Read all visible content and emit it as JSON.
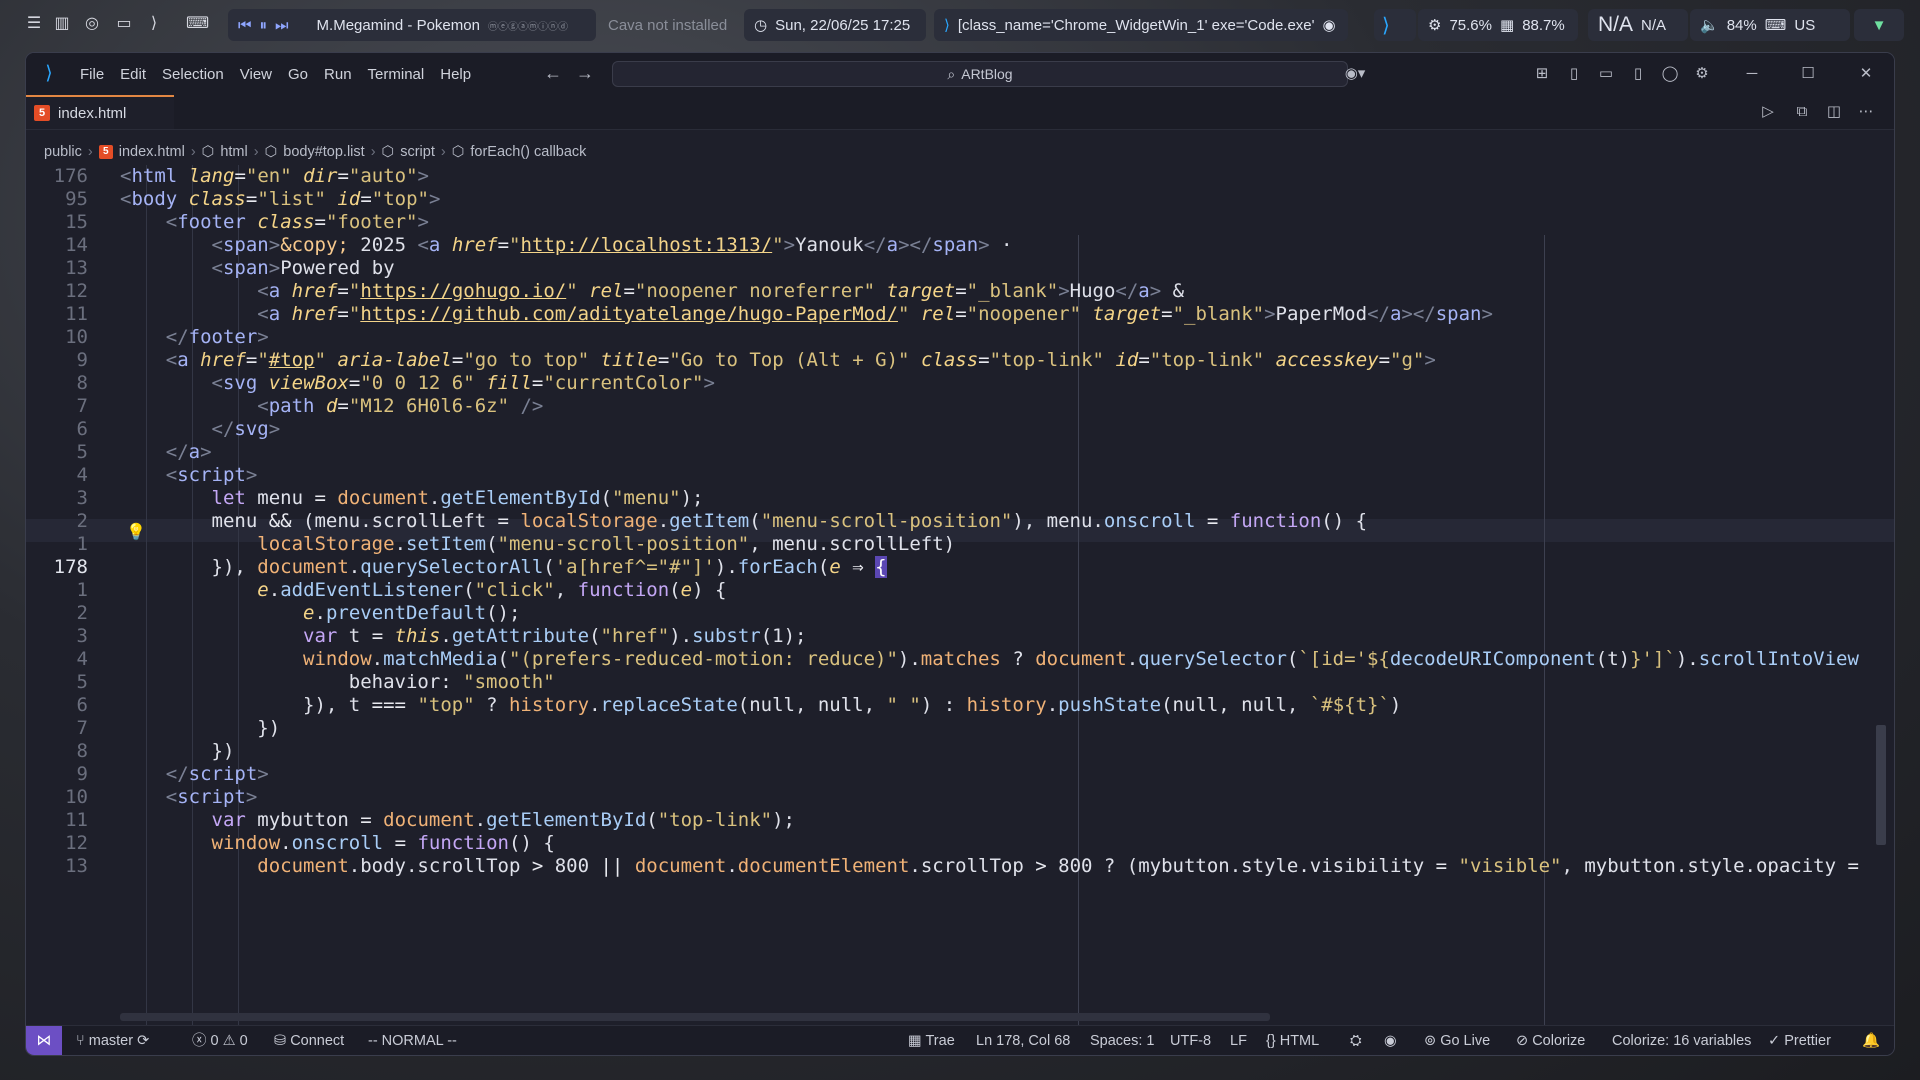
{
  "sysbar": {
    "media_title": "M.Megamind - Pokemon",
    "media_sub": "ⓜⓔⓖⓐⓜⓘⓝⓓ",
    "cava": "Cava not installed",
    "datetime": "Sun, 22/06/25 17:25",
    "window_info": "[class_name='Chrome_WidgetWin_1' exe='Code.exe'",
    "cpu": "75.6%",
    "mem": "88.7%",
    "na_big": "N/A",
    "na_small": "N/A",
    "volume": "84%",
    "lang": "US"
  },
  "titlebar": {
    "menu": [
      "File",
      "Edit",
      "Selection",
      "View",
      "Go",
      "Run",
      "Terminal",
      "Help"
    ],
    "search": "ARtBlog"
  },
  "tab": {
    "filename": "index.html"
  },
  "breadcrumbs": [
    "public",
    "index.html",
    "html",
    "body#top.list",
    "script",
    "forEach() callback"
  ],
  "editor": {
    "line_numbers": [
      "176",
      "95",
      "15",
      "14",
      "13",
      "12",
      "11",
      "10",
      "9",
      "8",
      "7",
      "6",
      "5",
      "4",
      "3",
      "2",
      "1",
      "178",
      "1",
      "2",
      "3",
      "4",
      "5",
      "6",
      "7",
      "8",
      "9",
      "10",
      "11",
      "12",
      "13"
    ],
    "current_line_index": 17
  },
  "statusbar": {
    "branch": "master",
    "errors": "0",
    "warnings": "0",
    "connect": "Connect",
    "mode": "-- NORMAL --",
    "trae": "Trae",
    "position": "Ln 178, Col 68",
    "spaces": "Spaces: 1",
    "encoding": "UTF-8",
    "eol": "LF",
    "language": "HTML",
    "golive": "Go Live",
    "colorize": "Colorize",
    "colorize_vars": "Colorize: 16 variables",
    "prettier": "Prettier"
  }
}
